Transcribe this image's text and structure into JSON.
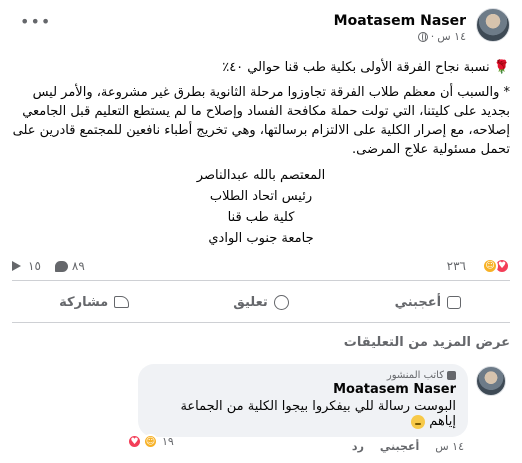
{
  "post": {
    "author": "Moatasem Naser",
    "time": "١٤ س",
    "privacy_icon": "globe-icon",
    "more_icon": "more-icon",
    "headline": "🌹 نسبة نجاح الفرقة الأولى بكلية طب قنا حوالي ٤٠٪",
    "body": "* والسبب أن معظم طلاب الفرقة تجاوزوا مرحلة الثانوية بطرق غير مشروعة، والأمر ليس بجديد على كليتنا، التي تولت حملة مكافحة الفساد وإصلاح ما لم يستطع التعليم قبل الجامعي إصلاحه، مع إصرار الكلية على الالتزام برسالتها، وهي تخريج أطباء نافعين للمجتمع قادرين على تحمل مسئولية علاج المرضى.",
    "signature": [
      "المعتصم بالله عبدالناصر",
      "رئيس اتحاد الطلاب",
      "كلية طب قنا",
      "جامعة جنوب الوادي"
    ]
  },
  "reactions": {
    "count": "٢٣٦",
    "comments_count": "٨٩",
    "shares_count": "١٥",
    "colors": {
      "love": "#f33e58",
      "haha": "#f7b125"
    }
  },
  "actions": {
    "like": "أعجبني",
    "comment": "تعليق",
    "share": "مشاركة"
  },
  "view_more": "عرض المزيد من التعليقات",
  "comment": {
    "badge": "كاتب المنشور",
    "author": "Moatasem Naser",
    "text": "البوست رسالة للي بيفكروا بيجوا الكلية من الجماعة إياهم",
    "time": "١٤ س",
    "like": "أعجبني",
    "reply": "رد",
    "react_count": "١٩"
  }
}
